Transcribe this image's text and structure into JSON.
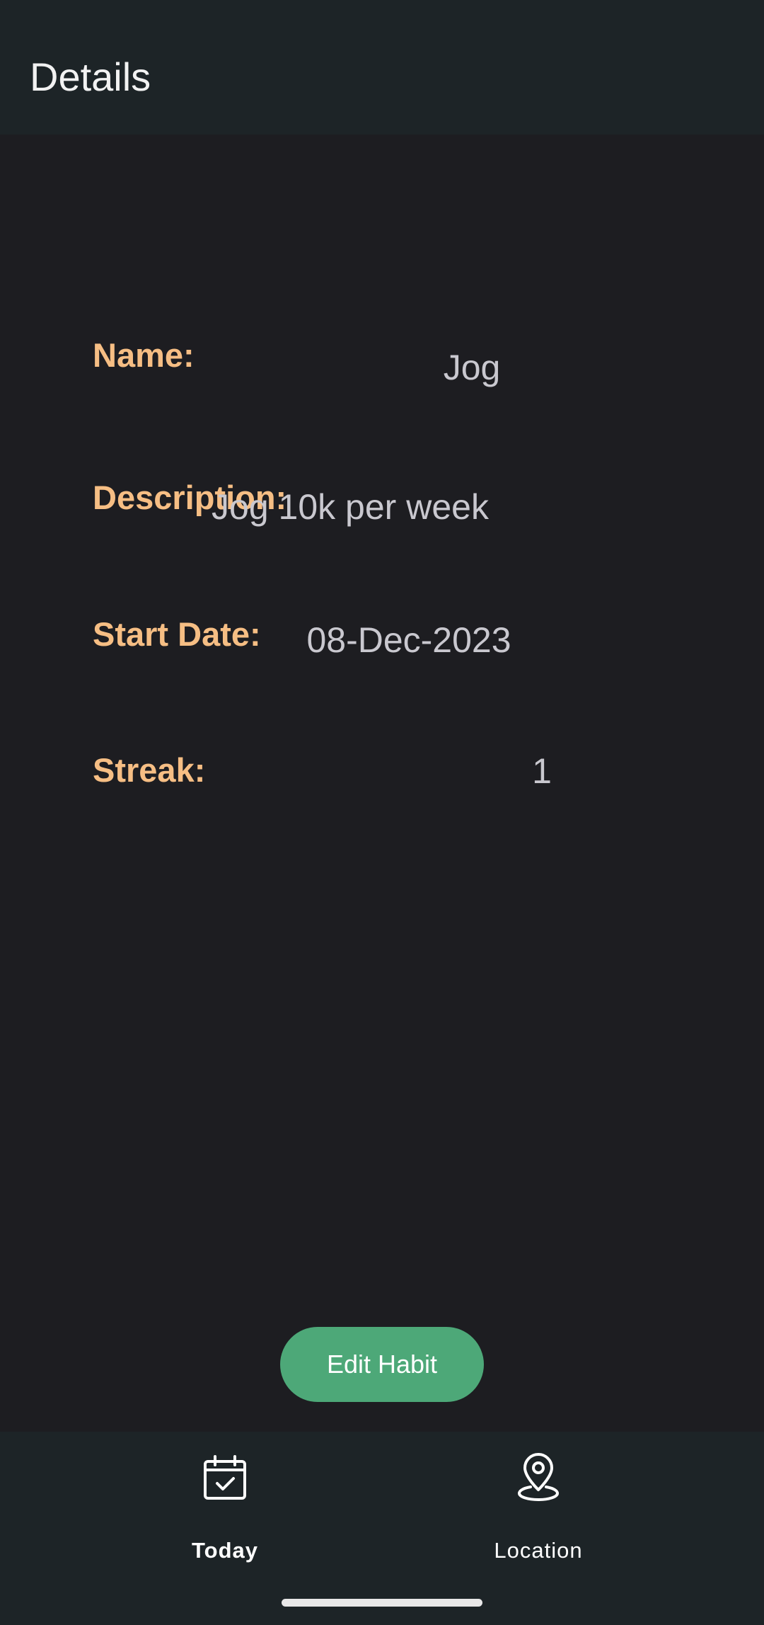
{
  "app_bar": {
    "title": "Details"
  },
  "details": {
    "name_label": "Name:",
    "name_value": "Jog",
    "description_label": "Description:",
    "description_value": "Jog 10k per week",
    "start_date_label": "Start Date:",
    "start_date_value": "08-Dec-2023",
    "streak_label": "Streak:",
    "streak_value": "1"
  },
  "actions": {
    "edit_label": "Edit Habit"
  },
  "bottom_nav": {
    "items": [
      {
        "label": "Today",
        "icon": "calendar-check-icon",
        "active": true
      },
      {
        "label": "Location",
        "icon": "map-pin-icon",
        "active": false
      }
    ]
  },
  "colors": {
    "background": "#1d1d21",
    "bar_background": "#1d2427",
    "label_accent": "#f6be84",
    "value_text": "#c9c8cf",
    "button": "#4da878"
  }
}
